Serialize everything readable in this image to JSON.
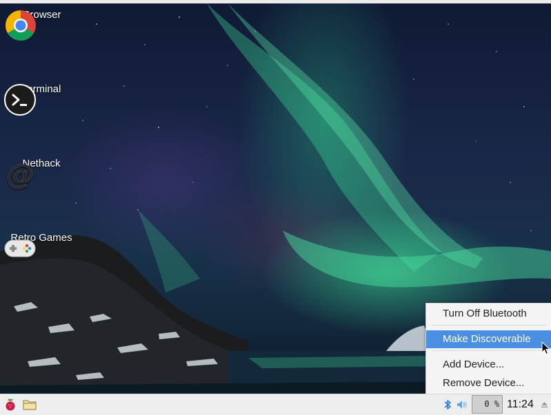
{
  "desktop": {
    "icons": [
      {
        "label": "Browser",
        "icon": "chromium-icon"
      },
      {
        "label": "Terminal",
        "icon": "terminal-icon"
      },
      {
        "label": "Nethack",
        "icon": "nethack-icon"
      },
      {
        "label": "Retro Games",
        "icon": "gamepad-icon"
      }
    ]
  },
  "bluetooth_menu": {
    "items": [
      {
        "label": "Turn Off Bluetooth",
        "highlighted": false
      },
      {
        "label": "Make Discoverable",
        "highlighted": true
      },
      {
        "label": "Add Device...",
        "highlighted": false
      },
      {
        "label": "Remove Device...",
        "highlighted": false
      }
    ]
  },
  "taskbar": {
    "menu_icon": "raspberry-icon",
    "file_manager_icon": "folder-icon",
    "tray_icons": [
      "bluetooth-icon",
      "volume-icon",
      "eject-icon"
    ],
    "cpu_usage": "0 %",
    "clock": "11:24"
  },
  "colors": {
    "menu_highlight": "#4a8fe2",
    "taskbar_bg": "#eeeeee",
    "bluetooth_blue": "#2a7ad8"
  }
}
